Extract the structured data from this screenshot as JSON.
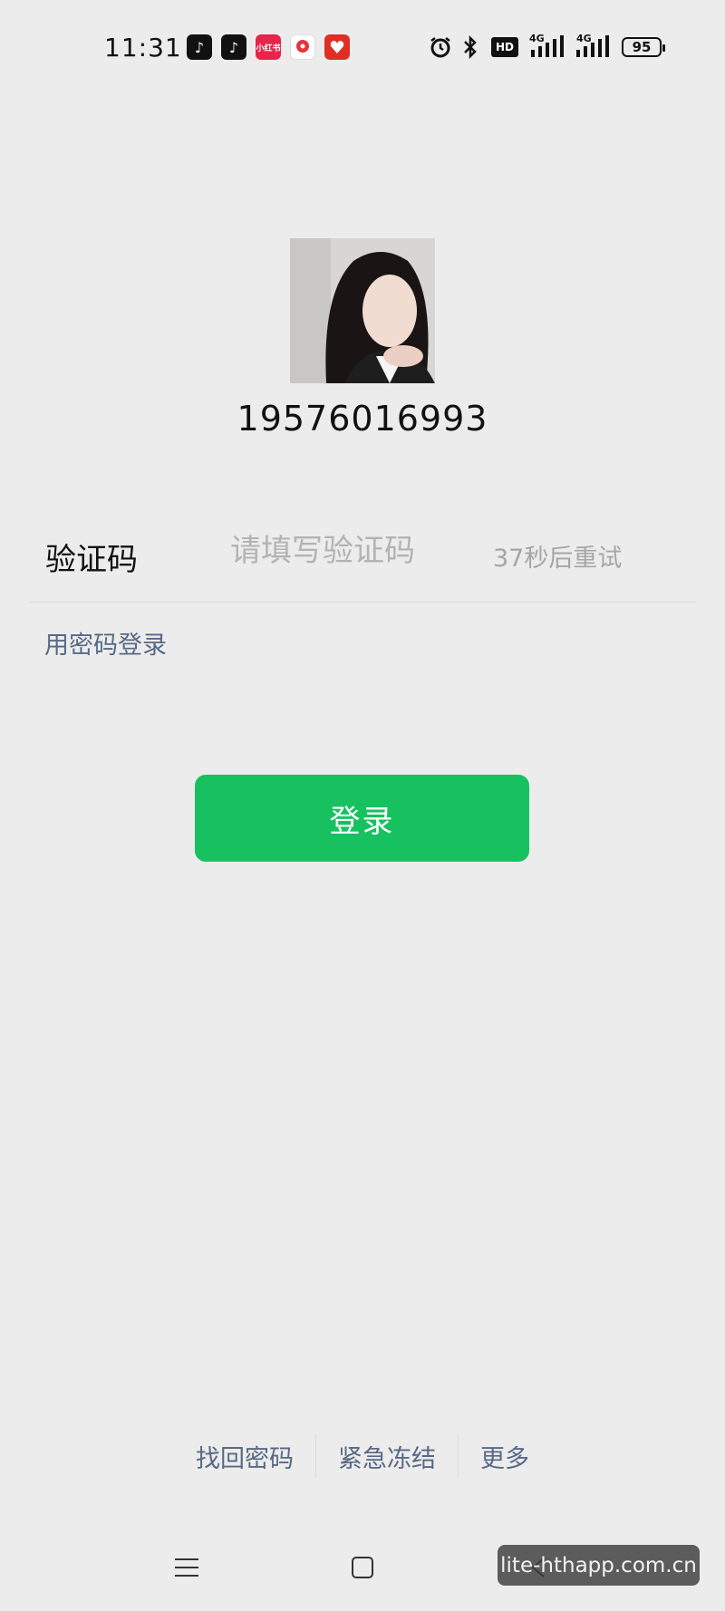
{
  "status_bar": {
    "time": "11:31",
    "hd_label": "HD",
    "network_1": "4G",
    "network_2": "4G",
    "battery": "95",
    "app_icons": [
      "douyin-icon",
      "douyin-lite-icon",
      "xiaohongshu-icon",
      "music-app-icon",
      "pinduoduo-icon"
    ],
    "system_icons": [
      "alarm-icon",
      "bluetooth-icon",
      "hd-icon",
      "signal-icon",
      "signal-icon",
      "battery-icon"
    ]
  },
  "account": {
    "phone": "19576016993"
  },
  "verification": {
    "label": "验证码",
    "placeholder": "请填写验证码",
    "retry_text": "37秒后重试"
  },
  "password_login_link": "用密码登录",
  "login_button": "登录",
  "bottom_links": {
    "recover_password": "找回密码",
    "emergency_freeze": "紧急冻结",
    "more": "更多"
  },
  "nav_bar": {
    "icons": [
      "menu-icon",
      "home-icon",
      "back-icon"
    ]
  },
  "watermark": "lite-hthapp.com.cn",
  "colors": {
    "background": "#ececec",
    "accent_green": "#17c160",
    "link_blue": "#586985"
  }
}
